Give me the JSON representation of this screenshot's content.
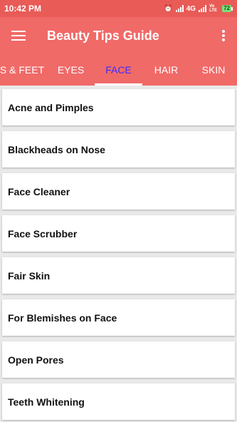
{
  "status_bar": {
    "time": "10:42 PM",
    "network": "4G",
    "volte": "Vo LTE",
    "battery": "72"
  },
  "app_bar": {
    "title": "Beauty Tips Guide"
  },
  "tabs": [
    {
      "label": "IS & FEET",
      "active": false
    },
    {
      "label": "EYES",
      "active": false
    },
    {
      "label": "FACE",
      "active": true
    },
    {
      "label": "HAIR",
      "active": false
    },
    {
      "label": "SKIN",
      "active": false
    }
  ],
  "items": [
    {
      "label": "Acne and Pimples"
    },
    {
      "label": "Blackheads on Nose"
    },
    {
      "label": "Face Cleaner"
    },
    {
      "label": "Face Scrubber"
    },
    {
      "label": "Fair Skin"
    },
    {
      "label": "For Blemishes on Face"
    },
    {
      "label": "Open Pores"
    },
    {
      "label": "Teeth Whitening"
    }
  ],
  "colors": {
    "status_bar": "#e85b57",
    "app_bar": "#f06a68",
    "active_tab_text": "#3d2cff"
  }
}
